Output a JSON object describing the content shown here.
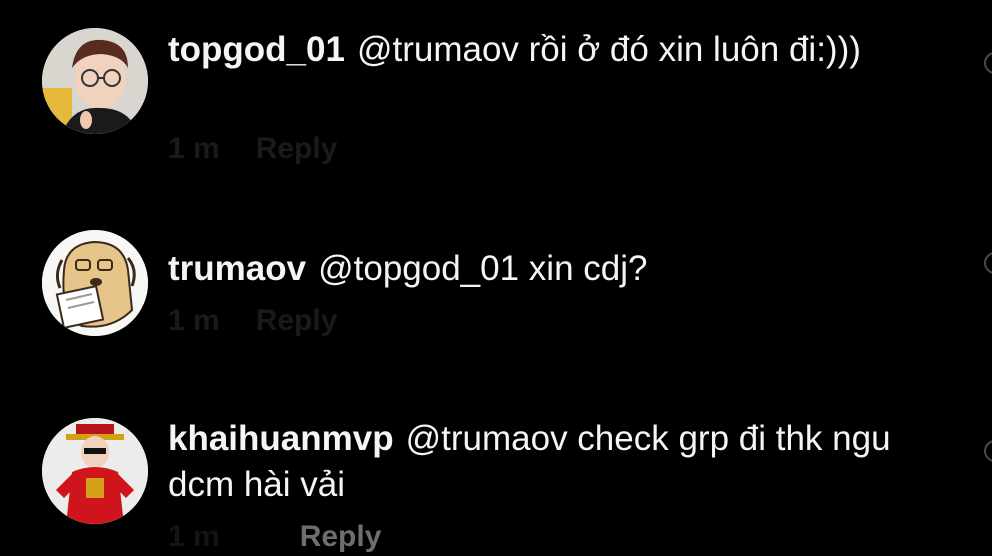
{
  "comments": [
    {
      "username": "topgod_01",
      "text": "@trumaov rồi ở đó xin luôn đi:)))",
      "time": "1 m",
      "reply_label": "Reply",
      "avatar_icon": "person-with-glasses"
    },
    {
      "username": "trumaov",
      "text": "@topgod_01 xin cdj?",
      "time": "1 m",
      "reply_label": "Reply",
      "avatar_icon": "cartoon-dog-reading"
    },
    {
      "username": "khaihuanmvp",
      "text": "@trumaov check grp đi thk ngu dcm hài vải",
      "time": "1 m",
      "reply_label": "Reply",
      "avatar_icon": "person-in-red-costume"
    }
  ],
  "colors": {
    "background": "#000000",
    "text": "#f5f5f5",
    "meta": "#6e6e6e"
  }
}
